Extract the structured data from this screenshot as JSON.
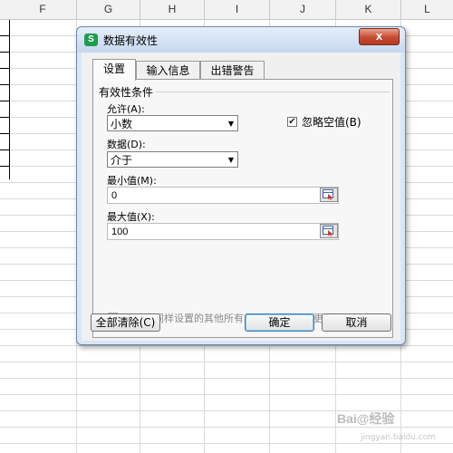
{
  "spreadsheet": {
    "columns": [
      "F",
      "G",
      "H",
      "I",
      "J",
      "K",
      "L"
    ]
  },
  "dialog": {
    "title": "数据有效性",
    "close_label": "x",
    "app_icon_label": "S",
    "tabs": [
      {
        "label": "设置",
        "active": true
      },
      {
        "label": "输入信息",
        "active": false
      },
      {
        "label": "出错警告",
        "active": false
      }
    ],
    "settings": {
      "group_label": "有效性条件",
      "allow_label": "允许(A):",
      "allow_value": "小数",
      "ignore_blank_checked": true,
      "ignore_blank_label": "忽略空值(B)",
      "data_label": "数据(D):",
      "data_value": "介于",
      "min_label": "最小值(M):",
      "min_value": "0",
      "max_label": "最大值(X):",
      "max_value": "100",
      "apply_all_checked": false,
      "apply_all_label": "对所有同样设置的其他所有单元格应用这些更改(P)"
    },
    "buttons": {
      "clear_all": "全部清除(C)",
      "ok": "确定",
      "cancel": "取消"
    }
  },
  "icons": {
    "close": "close-icon",
    "dropdown": "chevron-down-icon",
    "range_select": "range-select-icon",
    "check": "check-icon"
  },
  "watermark": {
    "text": "Bai@经验",
    "sub": "jingyan.baidu.com"
  }
}
